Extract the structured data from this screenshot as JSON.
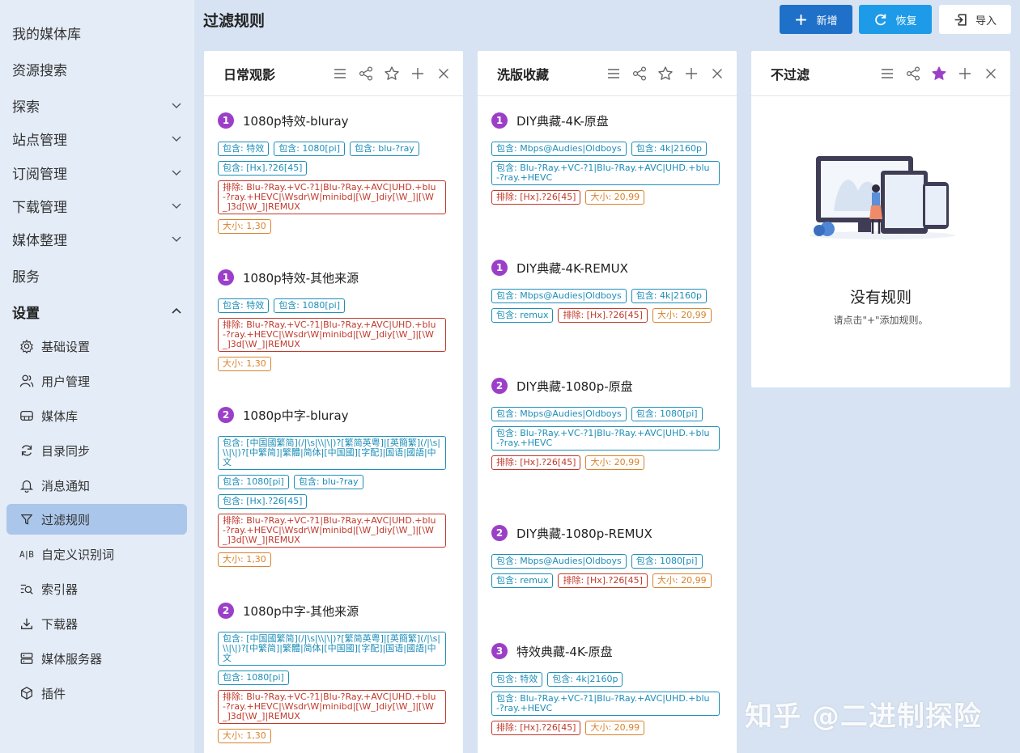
{
  "sidebar": {
    "top_items": [
      {
        "label": "我的媒体库"
      },
      {
        "label": "资源搜索"
      },
      {
        "label": "探索"
      },
      {
        "label": "站点管理"
      },
      {
        "label": "订阅管理"
      },
      {
        "label": "下载管理"
      },
      {
        "label": "媒体整理"
      },
      {
        "label": "服务"
      },
      {
        "label": "设置"
      }
    ],
    "sub_items": [
      {
        "label": "基础设置",
        "icon": "gear-icon"
      },
      {
        "label": "用户管理",
        "icon": "users-icon"
      },
      {
        "label": "媒体库",
        "icon": "media-library-icon"
      },
      {
        "label": "目录同步",
        "icon": "sync-icon"
      },
      {
        "label": "消息通知",
        "icon": "bell-icon"
      },
      {
        "label": "过滤规则",
        "icon": "filter-icon"
      },
      {
        "label": "自定义识别词",
        "icon": "ab-icon",
        "glyph": "A|B"
      },
      {
        "label": "索引器",
        "icon": "indexer-icon"
      },
      {
        "label": "下载器",
        "icon": "download-icon"
      },
      {
        "label": "媒体服务器",
        "icon": "server-icon"
      },
      {
        "label": "插件",
        "icon": "plugin-icon"
      }
    ]
  },
  "header": {
    "title": "过滤规则",
    "add_label": "新增",
    "restore_label": "恢复",
    "import_label": "导入"
  },
  "colors": {
    "accent": "#1f70c8",
    "badge": "#9b3fc9",
    "include": "#1d8eb8",
    "exclude": "#c0392b",
    "size": "#d9822b",
    "active_star": "#9b3fc9"
  },
  "groups": [
    {
      "title": "日常观影",
      "rules": [
        {
          "priority": "1",
          "name": "1080p特效-bluray",
          "tags": [
            {
              "type": "inc",
              "text": "包含: 特效"
            },
            {
              "type": "inc",
              "text": "包含: 1080[pi]"
            },
            {
              "type": "inc",
              "text": "包含: blu-?ray"
            },
            {
              "type": "inc",
              "text": "包含: [Hx].?26[45]"
            },
            {
              "type": "exc",
              "text": "排除: Blu-?Ray.+VC-?1|Blu-?Ray.+AVC|UHD.+blu-?ray.+HEVC|\\Wsdr\\W|minibd|[\\W_]diy[\\W_]|[\\W_]3d[\\W_]|REMUX"
            },
            {
              "type": "size",
              "text": "大小: 1,30"
            }
          ]
        },
        {
          "priority": "1",
          "name": "1080p特效-其他来源",
          "tags": [
            {
              "type": "inc",
              "text": "包含: 特效"
            },
            {
              "type": "inc",
              "text": "包含: 1080[pi]"
            },
            {
              "type": "exc",
              "text": "排除: Blu-?Ray.+VC-?1|Blu-?Ray.+AVC|UHD.+blu-?ray.+HEVC|\\Wsdr\\W|minibd|[\\W_]diy[\\W_]|[\\W_]3d[\\W_]|REMUX"
            },
            {
              "type": "size",
              "text": "大小: 1,30"
            }
          ]
        },
        {
          "priority": "2",
          "name": "1080p中字-bluray",
          "tags": [
            {
              "type": "inc long",
              "text": "包含: [中国國繁简](/|\\s|\\\\|\\|)?[繁简英粤]|[英簡繁](/|\\s|\\\\|\\|)?[中繁简]|繁體|简体|[中国國][字配]|国语|國語|中文"
            },
            {
              "type": "inc",
              "text": "包含: 1080[pi]"
            },
            {
              "type": "inc",
              "text": "包含: blu-?ray"
            },
            {
              "type": "inc",
              "text": "包含: [Hx].?26[45]"
            },
            {
              "type": "exc",
              "text": "排除: Blu-?Ray.+VC-?1|Blu-?Ray.+AVC|UHD.+blu-?ray.+HEVC|\\Wsdr\\W|minibd|[\\W_]diy[\\W_]|[\\W_]3d[\\W_]|REMUX"
            },
            {
              "type": "size",
              "text": "大小: 1,30"
            }
          ]
        },
        {
          "priority": "2",
          "name": "1080p中字-其他来源",
          "tags": [
            {
              "type": "inc long",
              "text": "包含: [中国國繁简](/|\\s|\\\\|\\|)?[繁简英粤]|[英簡繁](/|\\s|\\\\|\\|)?[中繁简]|繁體|简体|[中国國][字配]|国语|國語|中文"
            },
            {
              "type": "inc",
              "text": "包含: 1080[pi]"
            },
            {
              "type": "exc",
              "text": "排除: Blu-?Ray.+VC-?1|Blu-?Ray.+AVC|UHD.+blu-?ray.+HEVC|\\Wsdr\\W|minibd|[\\W_]diy[\\W_]|[\\W_]3d[\\W_]|REMUX"
            },
            {
              "type": "size",
              "text": "大小: 1,30"
            }
          ]
        }
      ]
    },
    {
      "title": "洗版收藏",
      "rules": [
        {
          "priority": "1",
          "name": "DIY典藏-4K-原盘",
          "tags": [
            {
              "type": "inc",
              "text": "包含: Mbps@Audies|Oldboys"
            },
            {
              "type": "inc",
              "text": "包含: 4k|2160p"
            },
            {
              "type": "inc long",
              "text": "包含: Blu-?Ray.+VC-?1|Blu-?Ray.+AVC|UHD.+blu-?ray.+HEVC"
            },
            {
              "type": "exc-short",
              "text": "排除: [Hx].?26[45]"
            },
            {
              "type": "size",
              "text": "大小: 20,99"
            }
          ]
        },
        {
          "priority": "1",
          "name": "DIY典藏-4K-REMUX",
          "tags": [
            {
              "type": "inc",
              "text": "包含: Mbps@Audies|Oldboys"
            },
            {
              "type": "inc",
              "text": "包含: 4k|2160p"
            },
            {
              "type": "inc",
              "text": "包含: remux"
            },
            {
              "type": "exc-short",
              "text": "排除: [Hx].?26[45]"
            },
            {
              "type": "size",
              "text": "大小: 20,99"
            }
          ]
        },
        {
          "priority": "2",
          "name": "DIY典藏-1080p-原盘",
          "tags": [
            {
              "type": "inc",
              "text": "包含: Mbps@Audies|Oldboys"
            },
            {
              "type": "inc",
              "text": "包含: 1080[pi]"
            },
            {
              "type": "inc long",
              "text": "包含: Blu-?Ray.+VC-?1|Blu-?Ray.+AVC|UHD.+blu-?ray.+HEVC"
            },
            {
              "type": "exc-short",
              "text": "排除: [Hx].?26[45]"
            },
            {
              "type": "size",
              "text": "大小: 20,99"
            }
          ]
        },
        {
          "priority": "2",
          "name": "DIY典藏-1080p-REMUX",
          "tags": [
            {
              "type": "inc",
              "text": "包含: Mbps@Audies|Oldboys"
            },
            {
              "type": "inc",
              "text": "包含: 1080[pi]"
            },
            {
              "type": "inc",
              "text": "包含: remux"
            },
            {
              "type": "exc-short",
              "text": "排除: [Hx].?26[45]"
            },
            {
              "type": "size",
              "text": "大小: 20,99"
            }
          ]
        },
        {
          "priority": "3",
          "name": "特效典藏-4K-原盘",
          "tags": [
            {
              "type": "inc",
              "text": "包含: 特效"
            },
            {
              "type": "inc",
              "text": "包含: 4k|2160p"
            },
            {
              "type": "inc long",
              "text": "包含: Blu-?Ray.+VC-?1|Blu-?Ray.+AVC|UHD.+blu-?ray.+HEVC"
            },
            {
              "type": "exc-short",
              "text": "排除: [Hx].?26[45]"
            },
            {
              "type": "size",
              "text": "大小: 20,99"
            }
          ]
        }
      ]
    },
    {
      "title": "不过滤",
      "empty_title": "没有规则",
      "empty_hint": "请点击\"+\"添加规则。"
    }
  ],
  "watermark": "知乎 @二进制探险"
}
